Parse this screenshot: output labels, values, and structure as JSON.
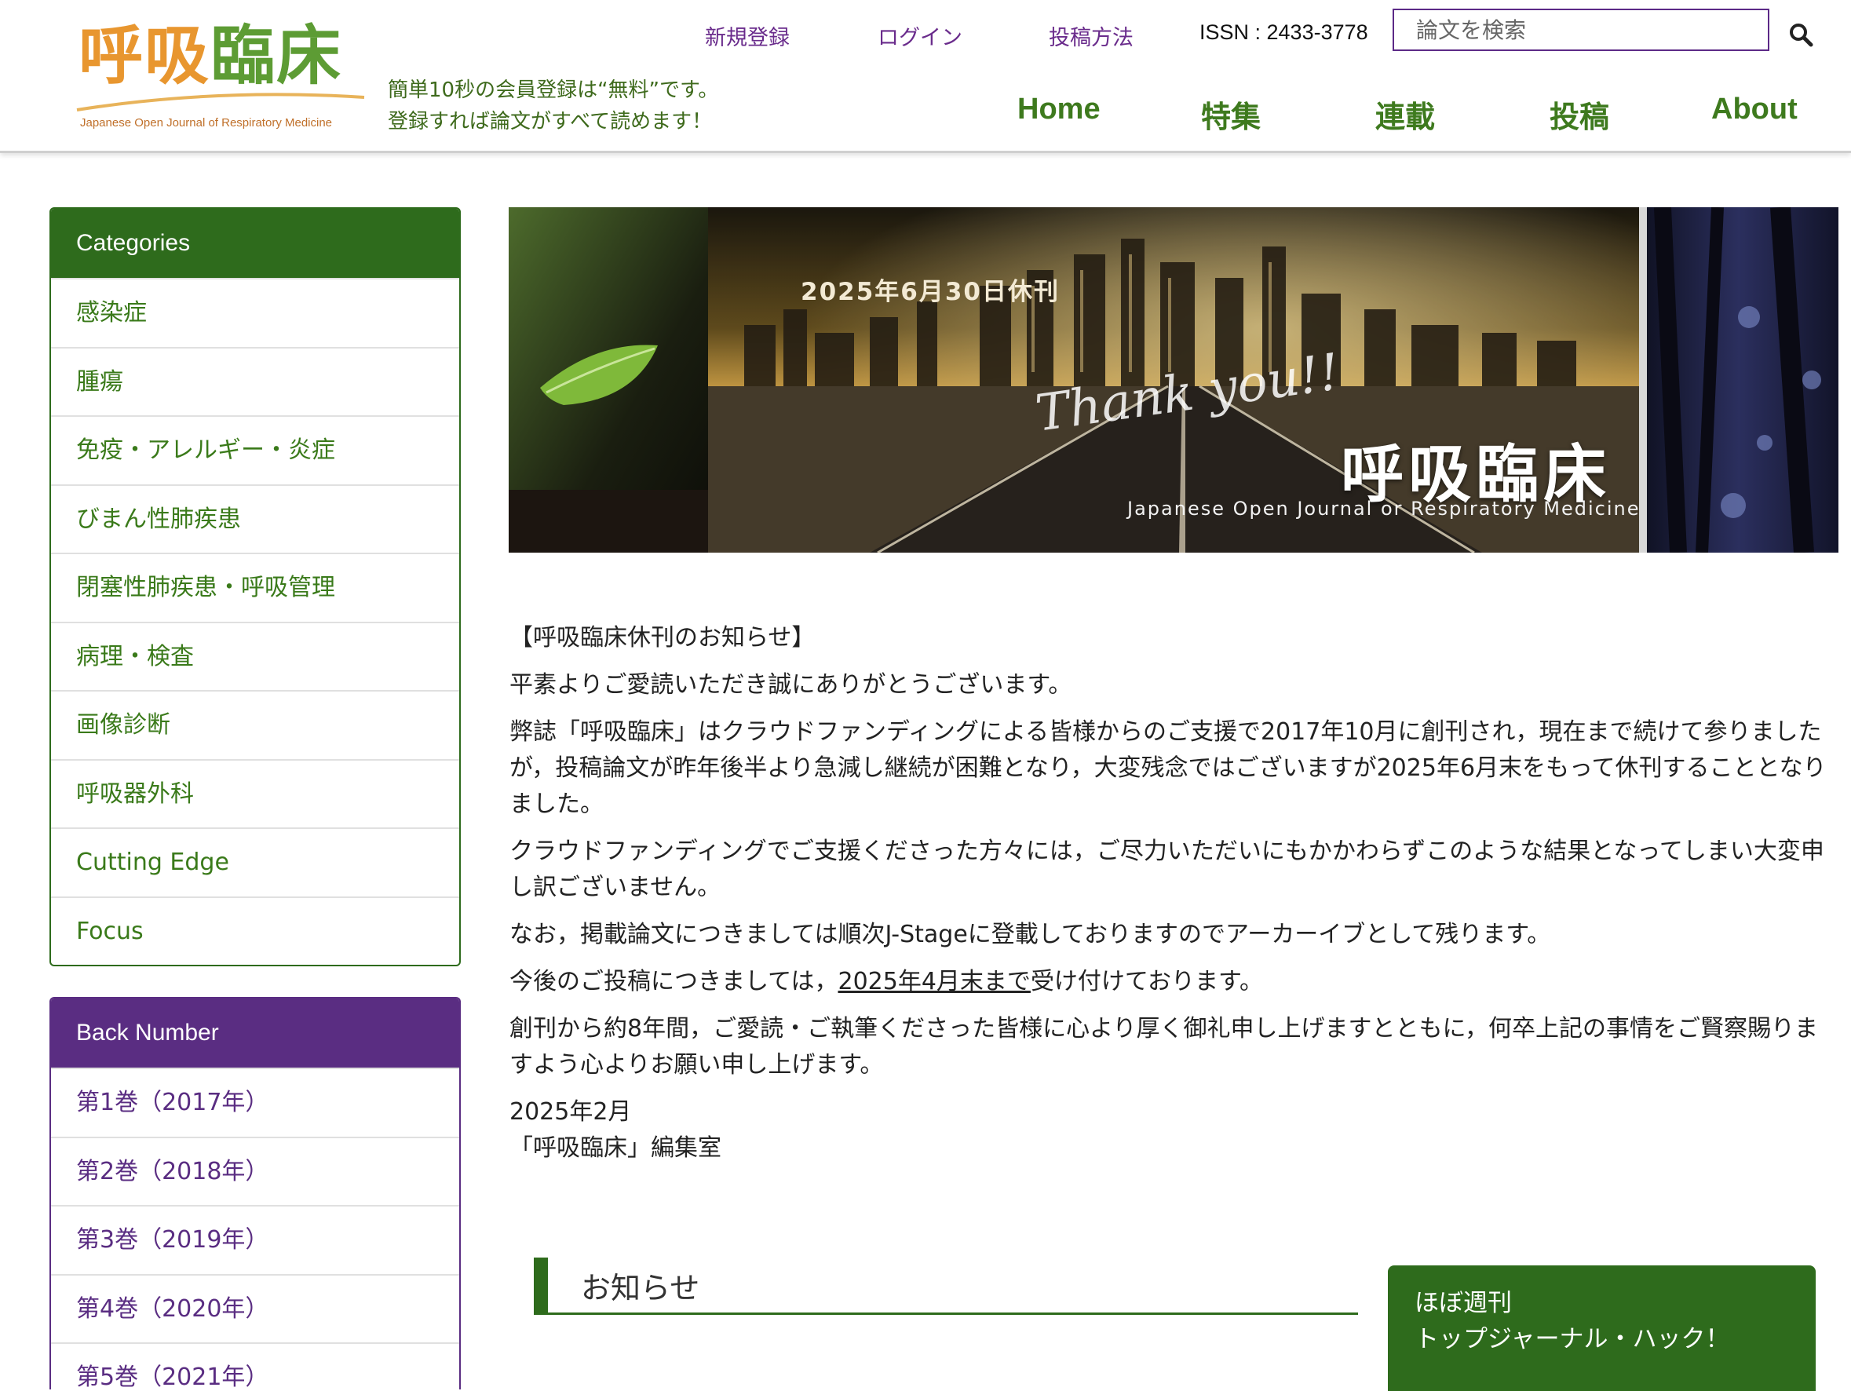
{
  "header": {
    "logo_part1": "呼吸",
    "logo_part2": "臨床",
    "logo_subtitle": "Japanese Open Journal of Respiratory Medicine",
    "promo_line1": "簡単10秒の会員登録は“無料”です。",
    "promo_line2": "登録すれば論文がすべて読めます！",
    "top_links": [
      "新規登録",
      "ログイン",
      "投稿方法"
    ],
    "issn": "ISSN : 2433-3778",
    "search_placeholder": "論文を検索",
    "search_icon": "search-icon",
    "nav": [
      "Home",
      "特集",
      "連載",
      "投稿",
      "About"
    ]
  },
  "sidebar": {
    "categories_title": "Categories",
    "categories": [
      "感染症",
      "腫瘍",
      "免疫・アレルギー・炎症",
      "びまん性肺疾患",
      "閉塞性肺疾患・呼吸管理",
      "病理・検査",
      "画像診断",
      "呼吸器外科",
      "Cutting Edge",
      "Focus"
    ],
    "back_number_title": "Back Number",
    "back_numbers": [
      "第1巻（2017年）",
      "第2巻（2018年）",
      "第3巻（2019年）",
      "第4巻（2020年）",
      "第5巻（2021年）"
    ]
  },
  "banner": {
    "date": "2025年6月30日休刊",
    "thanks": "Thank you!!",
    "brand": "呼吸臨床",
    "subtitle": "Japanese Open Journal or Respiratory Medicine"
  },
  "notice": {
    "heading": "【呼吸臨床休刊のお知らせ】",
    "p1": "平素よりご愛読いただき誠にありがとうございます。",
    "p2": "弊誌「呼吸臨床」はクラウドファンディングによる皆様からのご支援で2017年10月に創刊され，現在まで続けて参りましたが，投稿論文が昨年後半より急減し継続が困難となり，大変残念ではございますが2025年6月末をもって休刊することとなりました。",
    "p3": "クラウドファンディングでご支援くださった方々には，ご尽力いただいにもかかわらずこのような結果となってしまい大変申し訳ございません。",
    "p4": "なお，掲載論文につきましては順次J-Stageに登載しておりますのでアーカーイブとして残ります。",
    "p5_a": "今後のご投稿につきましては，",
    "p5_link": "2025年4月末まで",
    "p5_b": "受け付けております。",
    "p6": "創刊から約8年間，ご愛読・ご執筆くださった皆様に心より厚く御礼申し上げますとともに，何卒上記の事情をご賢察賜りますよう心よりお願い申し上げます。",
    "date": "2025年2月",
    "signature": "「呼吸臨床」編集室"
  },
  "news": {
    "title": "お知らせ"
  },
  "hack_box": {
    "line1": "ほぼ週刊",
    "line2": "トップジャーナル・ハック！"
  },
  "colors": {
    "green": "#2e6b1c",
    "purple": "#5a2d82",
    "logo_orange": "#e8962f",
    "logo_green": "#5d9c34"
  }
}
